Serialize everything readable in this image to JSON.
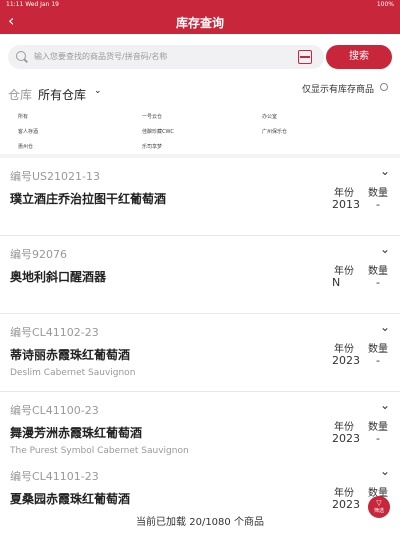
{
  "statusbar": {
    "left": "11:11 Wed Jan 19",
    "right": "100%"
  },
  "navbar": {
    "title": "库存查询",
    "back_icon": "chevron-left-icon"
  },
  "search": {
    "placeholder": "输入您要查找的商品货号/拼音码/名称",
    "button_label": "搜索",
    "scan_icon": "scan-icon"
  },
  "filter": {
    "warehouse_label": "仓库",
    "warehouse_value": "所有仓库",
    "stock_only_label": "仅显示有库存商品"
  },
  "warehouses": [
    "所有",
    "一号云仓",
    "办公室",
    "客人存酒",
    "佳酿珍藏CWC",
    "广州保乐仓",
    "惠州仓",
    "乐司享梦"
  ],
  "products": [
    {
      "code": "编号US21021-13",
      "name": "璞立酒庄乔治拉图干红葡萄酒",
      "en": "",
      "year_label": "年份",
      "year": "2013",
      "qty_label": "数量",
      "qty": "-"
    },
    {
      "code": "编号92076",
      "name": "奥地利斜口醒酒器",
      "en": "",
      "year_label": "年份",
      "year": "N",
      "qty_label": "数量",
      "qty": "-"
    },
    {
      "code": "编号CL41102-23",
      "name": "蒂诗丽赤霞珠红葡萄酒",
      "en": "Deslim Cabernet Sauvignon",
      "year_label": "年份",
      "year": "2023",
      "qty_label": "数量",
      "qty": "-"
    },
    {
      "code": "编号CL41100-23",
      "name": "舞漫芳洲赤霞珠红葡萄酒",
      "en": "The Purest Symbol Cabernet Sauvignon",
      "year_label": "年份",
      "year": "2023",
      "qty_label": "数量",
      "qty": "-"
    },
    {
      "code": "编号CL41101-23",
      "name": "夏桑园赤霞珠红葡萄酒",
      "en": "",
      "year_label": "年份",
      "year": "2023",
      "qty_label": "数量",
      "qty": "-"
    }
  ],
  "footer": {
    "text": "当前已加载 20/1080 个商品"
  },
  "fab": {
    "label": "筛选"
  },
  "colors": {
    "brand": "#c8263a",
    "muted": "#999999",
    "text": "#222222"
  }
}
